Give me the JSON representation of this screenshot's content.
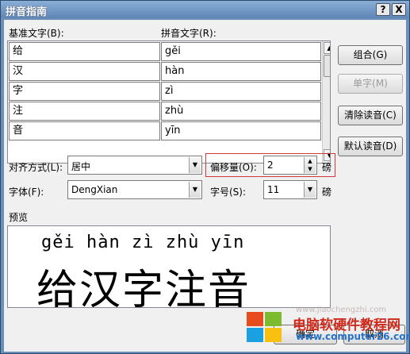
{
  "window": {
    "title": "拼音指南",
    "help_button": "?",
    "close_button": "X"
  },
  "labels": {
    "base_text": "基准文字(B):",
    "ruby_text": "拼音文字(R):",
    "alignment": "对齐方式(L):",
    "offset": "偏移量(O):",
    "font": "字体(F):",
    "size": "字号(S):",
    "preview": "预览",
    "offset_unit": "磅",
    "size_unit": "磅"
  },
  "rows": [
    {
      "base": "给",
      "ruby": "gěi"
    },
    {
      "base": "汉",
      "ruby": "hàn"
    },
    {
      "base": "字",
      "ruby": "zì"
    },
    {
      "base": "注",
      "ruby": "zhù"
    },
    {
      "base": "音",
      "ruby": "yīn"
    }
  ],
  "buttons": {
    "group": "组合(G)",
    "mono": "单字(M)",
    "clear": "清除读音(C)",
    "default": "默认读音(D)",
    "ok": "确定",
    "cancel": "取消"
  },
  "fields": {
    "alignment_value": "居中",
    "offset_value": "2",
    "font_value": "DengXian",
    "size_value": "11"
  },
  "preview": {
    "pinyin": "gěi hàn zì zhù yīn",
    "hanzi": "给汉字注音"
  },
  "watermark": {
    "title": "电脑软硬件教程网",
    "url": "www.computer26.com",
    "faint_url": "www.jiaochengzhi.com"
  },
  "colors": {
    "highlight_border": "#d03a3a",
    "title_bar": "#6b8fb8"
  }
}
